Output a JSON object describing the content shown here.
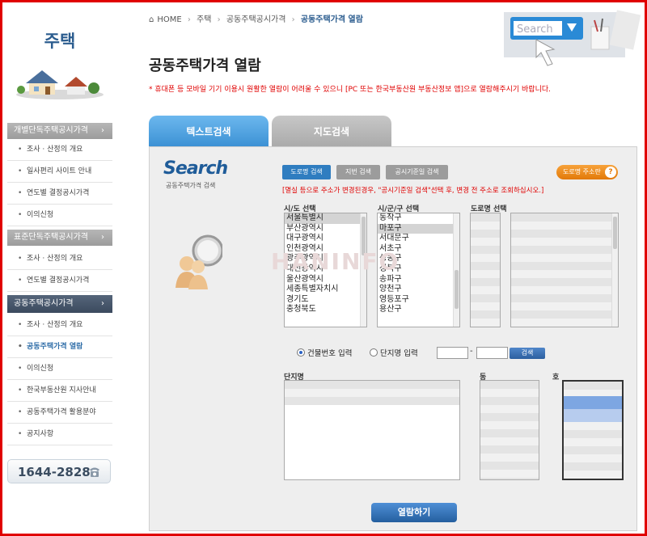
{
  "sidebar": {
    "title": "주택",
    "sections": [
      {
        "label": "개별단독주택공시가격",
        "arrow": "›"
      },
      {
        "label": "표준단독주택공시가격",
        "arrow": "›"
      },
      {
        "label": "공동주택공시가격",
        "arrow": "›"
      }
    ],
    "items1": [
      "조사 · 산정의 개요",
      "일사편리 사이트 안내",
      "연도별 결정공시가격",
      "이의신청"
    ],
    "items2": [
      "조사 · 산정의 개요",
      "연도별 결정공시가격"
    ],
    "items3": [
      "조사 · 산정의 개요",
      "공동주택가격 열람",
      "이의신청",
      "한국부동산원 지사안내",
      "공동주택가격 활용분야",
      "공지사항"
    ],
    "phone": "1644-2828"
  },
  "breadcrumb": {
    "home": "HOME",
    "sep": "›",
    "level1": "주택",
    "level2": "공동주택공시가격",
    "current": "공동주택가격 열람"
  },
  "page_title": "공동주택가격 열람",
  "notice": "* 휴대폰 등 모바일 기기 이용시 원활한 열람이 어려울 수 있으니 [PC 또는 한국부동산원 부동산정보 앱]으로 열람해주시기 바랍니다.",
  "header_illustration_text": "Search",
  "tabs": {
    "text_search": "텍스트검색",
    "map_search": "지도검색"
  },
  "search": {
    "logo": "Search",
    "sub": "공동주택가격 검색",
    "btn_road": "도로명 검색",
    "btn_jibun": "지번 검색",
    "btn_date": "공시기준일 검색",
    "btn_addr": "도로명 주소란",
    "btn_addr_q": "?",
    "warning": "[멸실 등으로 주소가 변경된경우, \"공시기준일 검색\"선택 후, 변경 전 주소로 조회하십시오.]",
    "label_sido": "시/도 선택",
    "label_sigungu": "시/군/구 선택",
    "label_road": "도로명 선택",
    "sido": [
      "서울특별시",
      "부산광역시",
      "대구광역시",
      "인천광역시",
      "광주광역시",
      "대전광역시",
      "울산광역시",
      "세종특별자치시",
      "경기도",
      "충청북도"
    ],
    "sigungu": [
      "동작구",
      "마포구",
      "서대문구",
      "서초구",
      "성동구",
      "성북구",
      "송파구",
      "양천구",
      "영등포구",
      "용산구"
    ],
    "watermark": "HANINFO",
    "radio_building": "건물번호 입력",
    "radio_complex": "단지명 입력",
    "dash": "-",
    "btn_search": "검색",
    "label_complex": "단지명",
    "label_dong": "동",
    "label_ho": "호",
    "btn_view": "열람하기"
  }
}
